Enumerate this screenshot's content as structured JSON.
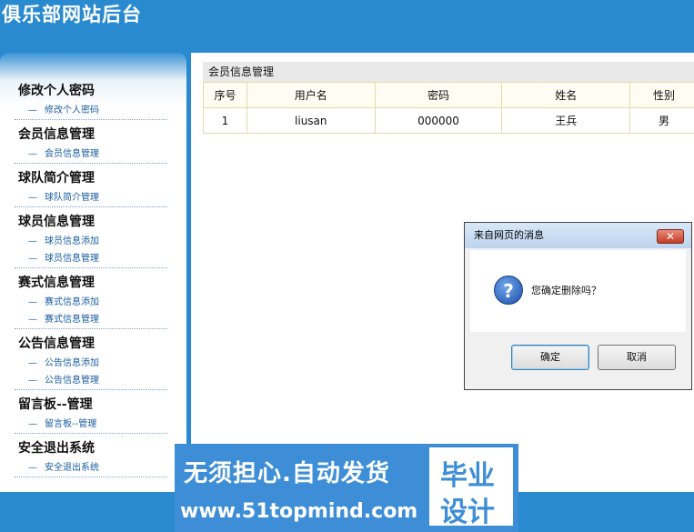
{
  "header": {
    "title": "俱乐部网站后台"
  },
  "sidebar": {
    "groups": [
      {
        "title": "修改个人密码",
        "items": [
          "修改个人密码"
        ]
      },
      {
        "title": "会员信息管理",
        "items": [
          "会员信息管理"
        ]
      },
      {
        "title": "球队简介管理",
        "items": [
          "球队简介管理"
        ]
      },
      {
        "title": "球员信息管理",
        "items": [
          "球员信息添加",
          "球员信息管理"
        ]
      },
      {
        "title": "赛式信息管理",
        "items": [
          "赛式信息添加",
          "赛式信息管理"
        ]
      },
      {
        "title": "公告信息管理",
        "items": [
          "公告信息添加",
          "公告信息管理"
        ]
      },
      {
        "title": "留言板--管理",
        "items": [
          "留言板--管理"
        ]
      },
      {
        "title": "安全退出系统",
        "items": [
          "安全退出系统"
        ]
      }
    ]
  },
  "main": {
    "panel_title": "会员信息管理",
    "columns": [
      "序号",
      "用户名",
      "密码",
      "姓名",
      "性别"
    ],
    "rows": [
      [
        "1",
        "liusan",
        "000000",
        "王兵",
        "男"
      ]
    ]
  },
  "dialog": {
    "title": "来自网页的消息",
    "message": "您确定删除吗？",
    "ok_label": "确定",
    "cancel_label": "取消",
    "close_glyph": "✕",
    "icon": "question-icon"
  },
  "watermark": {
    "line1": "无须担心.自动发货",
    "line2": "www.51topmind.com",
    "badge_line1": "毕业",
    "badge_line2": "设计"
  }
}
